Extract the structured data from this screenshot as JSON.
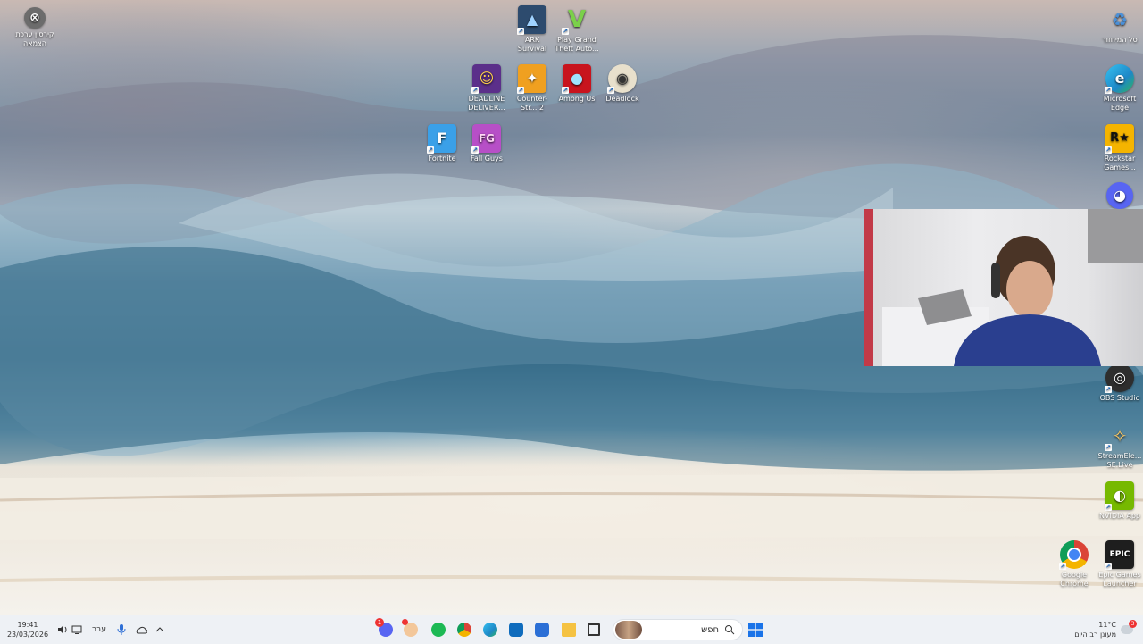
{
  "desktop_icons": [
    {
      "id": "xbox",
      "label": "קירסון ערכת הצמאה",
      "color": "#6c6c6c",
      "glyph": "⊗",
      "icon_name": "xbox-icon"
    },
    {
      "id": "ark",
      "label": "ARK Survival Ascended",
      "color": "#2d4b6e",
      "glyph": "▲",
      "icon_name": "ark-icon"
    },
    {
      "id": "gta",
      "label": "Play Grand Theft Auto...",
      "color": "#2b2b2b",
      "glyph": "V",
      "icon_name": "gta-v-icon"
    },
    {
      "id": "deadline",
      "label": "DEADLINE DELIVER...",
      "color": "#5b2f8a",
      "glyph": "☺",
      "icon_name": "deadline-delivery-icon"
    },
    {
      "id": "cs2",
      "label": "Counter-Str... 2",
      "color": "#f0a020",
      "glyph": "✦",
      "icon_name": "counter-strike-icon"
    },
    {
      "id": "amongus",
      "label": "Among Us",
      "color": "#c8141e",
      "glyph": "●",
      "icon_name": "among-us-icon"
    },
    {
      "id": "deadlock",
      "label": "Deadlock",
      "color": "#e8e0cc",
      "glyph": "◉",
      "icon_name": "deadlock-icon"
    },
    {
      "id": "fortnite",
      "label": "Fortnite",
      "color": "#3aa0e8",
      "glyph": "F",
      "icon_name": "fortnite-icon"
    },
    {
      "id": "fallguys",
      "label": "Fall Guys",
      "color": "#b74fc7",
      "glyph": "FG",
      "icon_name": "fall-guys-icon"
    },
    {
      "id": "recycle",
      "label": "סל המיחזור",
      "color": "#e7eef5",
      "glyph": "♻",
      "icon_name": "recycle-bin-icon"
    },
    {
      "id": "edge",
      "label": "Microsoft Edge",
      "color": "#1e88c7",
      "glyph": "e",
      "icon_name": "edge-icon"
    },
    {
      "id": "rockstar",
      "label": "Rockstar Games...",
      "color": "#f5b400",
      "glyph": "R★",
      "icon_name": "rockstar-icon"
    },
    {
      "id": "discord",
      "label": "",
      "color": "#5865f2",
      "glyph": "◕",
      "icon_name": "discord-icon"
    },
    {
      "id": "obs",
      "label": "OBS Studio",
      "color": "#2e2e2e",
      "glyph": "◎",
      "icon_name": "obs-icon"
    },
    {
      "id": "streamelements",
      "label": "StreamEle... SE.Live",
      "color": "#6b4bb5",
      "glyph": "✧",
      "icon_name": "streamelements-icon"
    },
    {
      "id": "nvidia",
      "label": "NVIDIA App",
      "color": "#76b900",
      "glyph": "◐",
      "icon_name": "nvidia-icon"
    },
    {
      "id": "chrome",
      "label": "Google Chrome",
      "color": "#ffffff",
      "glyph": "◍",
      "icon_name": "chrome-icon"
    },
    {
      "id": "epic",
      "label": "Epic Games Launcher",
      "color": "#1e1e1e",
      "glyph": "EPIC",
      "icon_name": "epic-games-icon"
    }
  ],
  "taskbar": {
    "search_placeholder": "חפש",
    "apps": [
      {
        "id": "discord",
        "color": "#5865f2",
        "badge": "1",
        "icon_name": "discord-icon"
      },
      {
        "id": "record",
        "color": "#f3c79a",
        "badge": "",
        "icon_name": "recording-icon"
      },
      {
        "id": "spotify",
        "color": "#1db954",
        "badge": "",
        "icon_name": "spotify-icon"
      },
      {
        "id": "chrome",
        "color": "#db4437",
        "badge": "",
        "icon_name": "chrome-icon"
      },
      {
        "id": "edge",
        "color": "#1e88c7",
        "badge": "",
        "icon_name": "edge-icon"
      },
      {
        "id": "outlook",
        "color": "#0f6cbd",
        "badge": "",
        "icon_name": "outlook-icon"
      },
      {
        "id": "store",
        "color": "#2b6fd6",
        "badge": "",
        "icon_name": "store-icon"
      },
      {
        "id": "explorer",
        "color": "#f5c242",
        "badge": "",
        "icon_name": "file-explorer-icon"
      },
      {
        "id": "taskview",
        "color": "#333333",
        "badge": "",
        "icon_name": "task-view-icon"
      }
    ],
    "start_icon_color": "#1a73e8"
  },
  "tray": {
    "time": "19:41",
    "date": "23/03/2026",
    "language": "עבר",
    "weather_temp": "11°C",
    "weather_text": "מעונן רב היום",
    "weather_badge": "3"
  }
}
